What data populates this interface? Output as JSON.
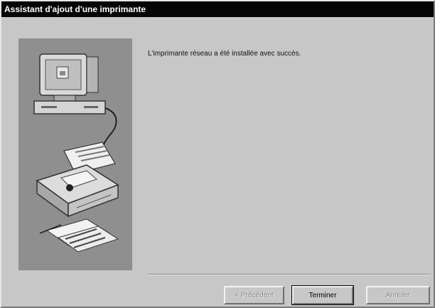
{
  "window": {
    "title": "Assistant d'ajout d'une imprimante"
  },
  "wizard": {
    "message": "L'imprimante réseau a été installée avec succès."
  },
  "buttons": {
    "previous": "< Précédent",
    "finish": "Terminer",
    "cancel": "Annuler"
  }
}
